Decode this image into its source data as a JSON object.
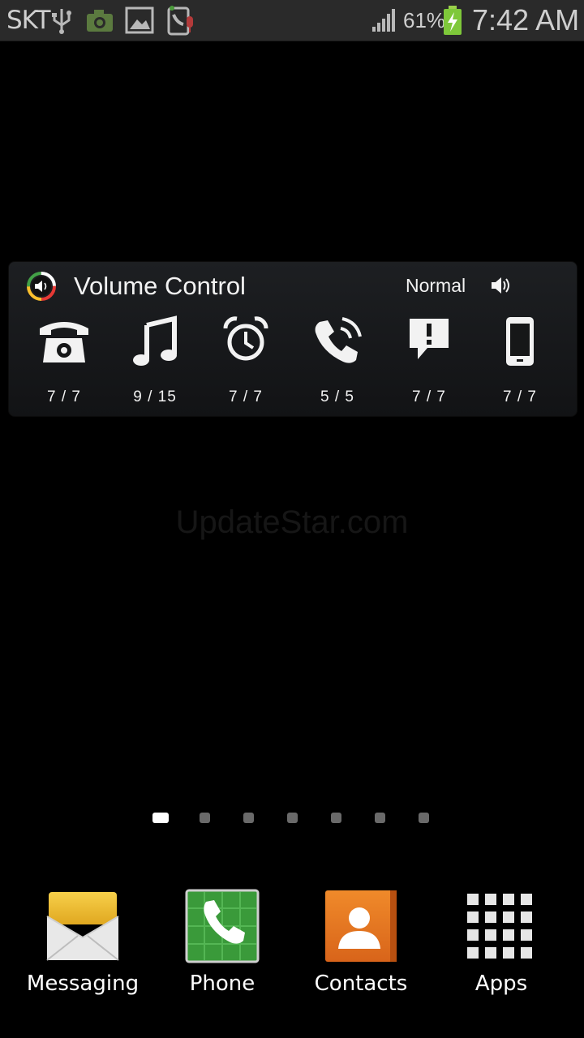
{
  "status_bar": {
    "carrier": "SKT",
    "battery_percent": "61%",
    "time": "7:42 AM",
    "icons": [
      "usb-icon",
      "camera-icon",
      "image-icon",
      "call-recorder-icon",
      "signal-icon",
      "battery-charging-icon"
    ]
  },
  "widget": {
    "title": "Volume Control",
    "mode": "Normal",
    "items": [
      {
        "icon": "ringtone-phone-icon",
        "value": "7 / 7"
      },
      {
        "icon": "music-icon",
        "value": "9 / 15"
      },
      {
        "icon": "alarm-icon",
        "value": "7 / 7"
      },
      {
        "icon": "voice-call-icon",
        "value": "5 / 5"
      },
      {
        "icon": "notification-icon",
        "value": "7 / 7"
      },
      {
        "icon": "system-icon",
        "value": "7 / 7"
      }
    ]
  },
  "watermark": "UpdateStar.com",
  "page_indicator": {
    "count": 7,
    "active": 1
  },
  "dock": [
    {
      "label": "Messaging",
      "icon": "messaging-icon"
    },
    {
      "label": "Phone",
      "icon": "phone-icon"
    },
    {
      "label": "Contacts",
      "icon": "contacts-icon"
    },
    {
      "label": "Apps",
      "icon": "apps-grid-icon"
    }
  ]
}
